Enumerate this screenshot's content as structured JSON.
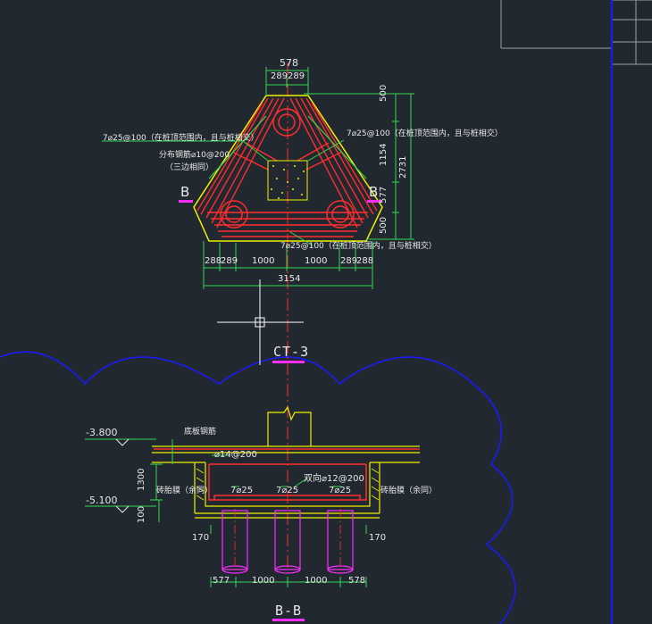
{
  "plan": {
    "title": "CT-3",
    "dims_top": {
      "total": "578",
      "left": "289",
      "right": "289"
    },
    "dims_bottom": {
      "a": "288",
      "b": "289",
      "c": "1000",
      "d": "1000",
      "e": "289",
      "f": "288",
      "total": "3154"
    },
    "dims_right": {
      "a": "500",
      "b": "1154",
      "c": "577",
      "d": "500",
      "total": "2731"
    },
    "notes": {
      "left_bars": "7⌀25@100（在桩顶范围内，且与桩相交）",
      "right_bars": "7⌀25@100（在桩顶范围内，且与桩相交）",
      "bottom_bars": "7⌀25@100（在桩顶范围内，且与桩相交）",
      "dist_bars": "分布钢筋⌀10@200",
      "dist_sub": "（三边相同）"
    },
    "section_marks": {
      "left": "B",
      "right": "B"
    }
  },
  "section": {
    "title": "B-B",
    "elev_top": "-3.800",
    "elev_bottom": "-5.100",
    "dim_height": "1300",
    "dim_pad": "100",
    "labels": {
      "bottom_slab_bars": "底板钢筋",
      "bar_1": "⌀14@200",
      "bar_2": "双向⌀12@200",
      "brick_left": "砖胎膜（余同）",
      "brick_right": "砖胎膜（余同）",
      "rebar_1": "7⌀25",
      "rebar_2": "7⌀25",
      "rebar_3": "7⌀25",
      "side_left": "170",
      "side_right": "170"
    },
    "dims_bottom": {
      "a": "577",
      "b": "1000",
      "c": "1000",
      "d": "578"
    }
  },
  "colors": {
    "bg": "#212830",
    "green": "#32d74b",
    "red": "#ff2d2d",
    "yellow": "#f0f000",
    "white": "#e8e8e8",
    "magenta": "#ff2cff",
    "blue": "#1a1aff"
  }
}
